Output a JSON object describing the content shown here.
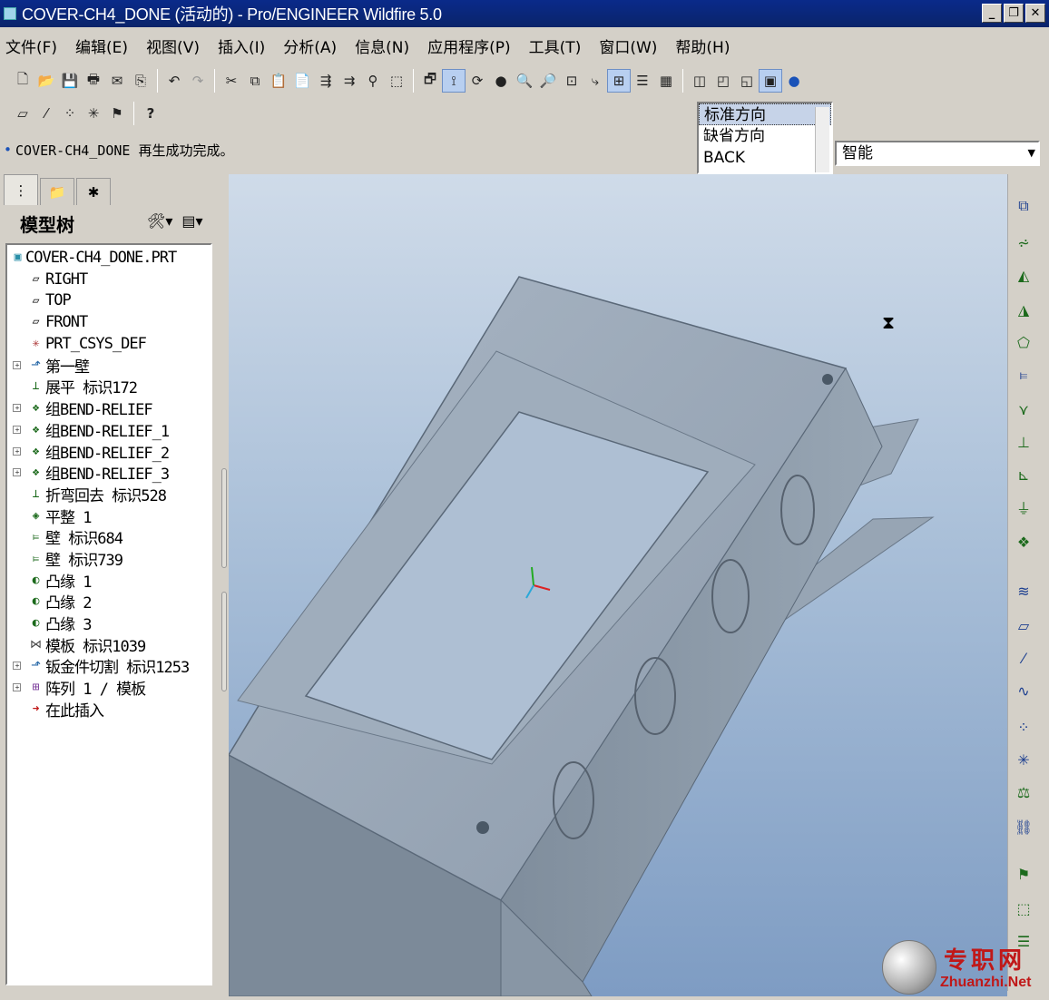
{
  "window": {
    "title": "COVER-CH4_DONE (活动的) - Pro/ENGINEER Wildfire 5.0",
    "buttons": [
      "_",
      "❐",
      "✕"
    ]
  },
  "menu": [
    "文件(F)",
    "编辑(E)",
    "视图(V)",
    "插入(I)",
    "分析(A)",
    "信息(N)",
    "应用程序(P)",
    "工具(T)",
    "窗口(W)",
    "帮助(H)"
  ],
  "status": {
    "message": "COVER-CH4_DONE 再生成功完成。"
  },
  "view_list": {
    "items": [
      "标准方向",
      "缺省方向",
      "BACK"
    ],
    "selected": "标准方向"
  },
  "filter": {
    "value": "智能"
  },
  "tree": {
    "title": "模型树",
    "items": [
      {
        "label": "COVER-CH4_DONE.PRT",
        "icon": "part-icon"
      },
      {
        "label": "RIGHT",
        "icon": "datum-plane-icon"
      },
      {
        "label": "TOP",
        "icon": "datum-plane-icon"
      },
      {
        "label": "FRONT",
        "icon": "datum-plane-icon"
      },
      {
        "label": "PRT_CSYS_DEF",
        "icon": "csys-icon"
      },
      {
        "label": "第一壁",
        "icon": "wall-icon"
      },
      {
        "label": "展平 标识172",
        "icon": "unbend-icon"
      },
      {
        "label": "组BEND-RELIEF",
        "icon": "group-icon"
      },
      {
        "label": "组BEND-RELIEF_1",
        "icon": "group-icon"
      },
      {
        "label": "组BEND-RELIEF_2",
        "icon": "group-icon"
      },
      {
        "label": "组BEND-RELIEF_3",
        "icon": "group-icon"
      },
      {
        "label": "折弯回去 标识528",
        "icon": "bend-back-icon"
      },
      {
        "label": "平整 1",
        "icon": "flat-wall-icon"
      },
      {
        "label": "壁 标识684",
        "icon": "wall-feature-icon"
      },
      {
        "label": "壁 标识739",
        "icon": "wall-feature-icon"
      },
      {
        "label": "凸缘 1",
        "icon": "flange-icon"
      },
      {
        "label": "凸缘 2",
        "icon": "flange-icon"
      },
      {
        "label": "凸缘 3",
        "icon": "flange-icon"
      },
      {
        "label": "模板 标识1039",
        "icon": "form-icon"
      },
      {
        "label": "钣金件切割 标识1253",
        "icon": "cut-icon"
      },
      {
        "label": "阵列 1 / 模板",
        "icon": "pattern-icon"
      },
      {
        "label": "在此插入",
        "icon": "insert-here-icon"
      }
    ]
  },
  "watermark": {
    "cn": "专职网",
    "en": "Zhuanzhi.Net"
  }
}
